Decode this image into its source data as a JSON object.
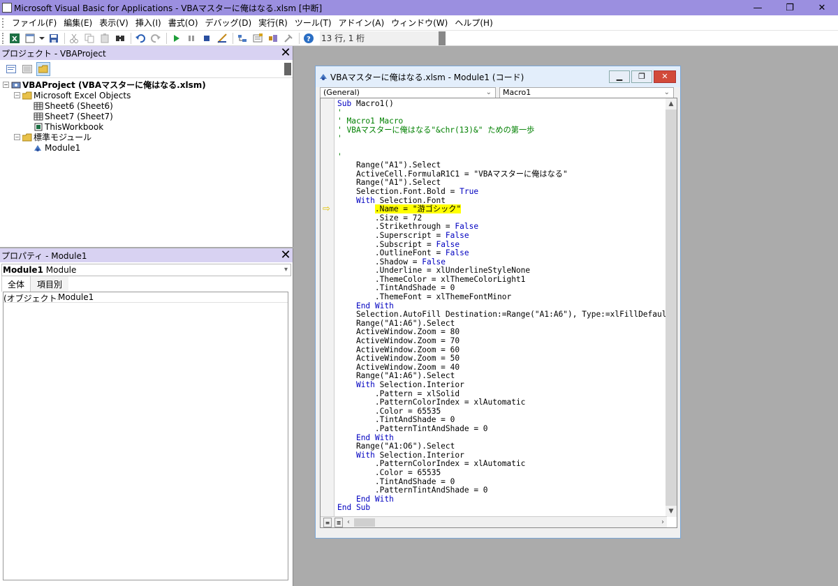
{
  "window": {
    "title": "Microsoft Visual Basic for Applications - VBAマスターに俺はなる.xlsm [中断]",
    "min_glyph": "—",
    "max_glyph": "❐",
    "close_glyph": "✕"
  },
  "menu": [
    "ファイル(F)",
    "編集(E)",
    "表示(V)",
    "挿入(I)",
    "書式(O)",
    "デバッグ(D)",
    "実行(R)",
    "ツール(T)",
    "アドイン(A)",
    "ウィンドウ(W)",
    "ヘルプ(H)"
  ],
  "toolbar": {
    "position": "13 行, 1 桁",
    "icons": [
      "excel-icon",
      "insert-module-icon",
      "save-icon",
      "cut-icon",
      "copy-icon",
      "paste-icon",
      "find-icon",
      "undo-icon",
      "redo-icon",
      "run-icon",
      "break-icon",
      "reset-icon",
      "design-mode-icon",
      "project-explorer-icon",
      "properties-icon",
      "object-browser-icon",
      "toolbox-icon",
      "help-icon"
    ]
  },
  "project_panel": {
    "title": "プロジェクト - VBAProject",
    "tree": [
      {
        "label": "VBAProject (VBAマスターに俺はなる.xlsm)",
        "level": 0,
        "expander": "−",
        "bold": true,
        "icon": "vba-project-icon"
      },
      {
        "label": "Microsoft Excel Objects",
        "level": 1,
        "expander": "−",
        "bold": false,
        "icon": "folder-icon"
      },
      {
        "label": "Sheet6 (Sheet6)",
        "level": 2,
        "expander": "",
        "bold": false,
        "icon": "sheet-icon"
      },
      {
        "label": "Sheet7 (Sheet7)",
        "level": 2,
        "expander": "",
        "bold": false,
        "icon": "sheet-icon"
      },
      {
        "label": "ThisWorkbook",
        "level": 2,
        "expander": "",
        "bold": false,
        "icon": "workbook-icon"
      },
      {
        "label": "標準モジュール",
        "level": 1,
        "expander": "−",
        "bold": false,
        "icon": "folder-icon"
      },
      {
        "label": "Module1",
        "level": 2,
        "expander": "",
        "bold": false,
        "icon": "module-icon"
      }
    ]
  },
  "props_panel": {
    "title": "プロパティ - Module1",
    "object_name": "Module1",
    "object_type": "Module",
    "tabs": [
      "全体",
      "項目別"
    ],
    "rows": [
      {
        "key": "(オブジェクト名)",
        "value": "Module1"
      }
    ]
  },
  "code_window": {
    "title": "VBAマスターに俺はなる.xlsm - Module1 (コード)",
    "object_combo": "(General)",
    "proc_combo": "Macro1",
    "current_line_index": 12,
    "lines": [
      "Sub Macro1()",
      "'",
      "' Macro1 Macro",
      "' VBAマスターに俺はなる\"&chr(13)&\" ための第一歩",
      "'",
      "",
      "'",
      "    Range(\"A1\").Select",
      "    ActiveCell.FormulaR1C1 = \"VBAマスターに俺はなる\"",
      "    Range(\"A1\").Select",
      "    Selection.Font.Bold = True",
      "    With Selection.Font",
      "        .Name = \"游ゴシック\"",
      "        .Size = 72",
      "        .Strikethrough = False",
      "        .Superscript = False",
      "        .Subscript = False",
      "        .OutlineFont = False",
      "        .Shadow = False",
      "        .Underline = xlUnderlineStyleNone",
      "        .ThemeColor = xlThemeColorLight1",
      "        .TintAndShade = 0",
      "        .ThemeFont = xlThemeFontMinor",
      "    End With",
      "    Selection.AutoFill Destination:=Range(\"A1:A6\"), Type:=xlFillDefault",
      "    Range(\"A1:A6\").Select",
      "    ActiveWindow.Zoom = 80",
      "    ActiveWindow.Zoom = 70",
      "    ActiveWindow.Zoom = 60",
      "    ActiveWindow.Zoom = 50",
      "    ActiveWindow.Zoom = 40",
      "    Range(\"A1:A6\").Select",
      "    With Selection.Interior",
      "        .Pattern = xlSolid",
      "        .PatternColorIndex = xlAutomatic",
      "        .Color = 65535",
      "        .TintAndShade = 0",
      "        .PatternTintAndShade = 0",
      "    End With",
      "    Range(\"A1:O6\").Select",
      "    With Selection.Interior",
      "        .PatternColorIndex = xlAutomatic",
      "        .Color = 65535",
      "        .TintAndShade = 0",
      "        .PatternTintAndShade = 0",
      "    End With",
      "End Sub"
    ]
  },
  "colors": {
    "title_bar": "#9b8fe0",
    "keyword": "#0000c0",
    "comment": "#008000",
    "highlight": "#ffff00",
    "exec_arrow": "#e0c000"
  }
}
